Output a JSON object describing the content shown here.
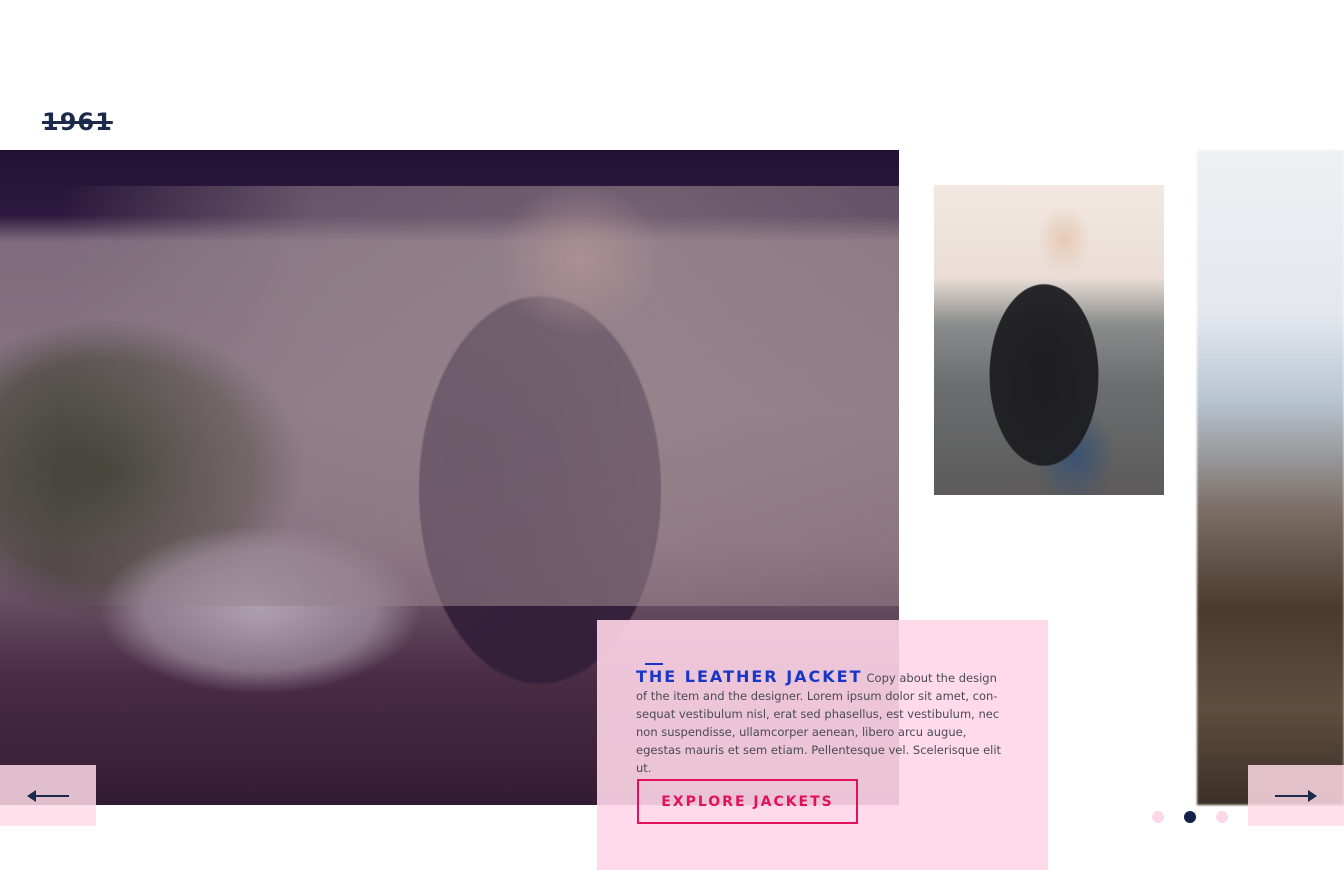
{
  "header": {
    "year": "1961"
  },
  "slide": {
    "title": "THE LEATHER JACKET",
    "copy": "Copy about the design of the item and the designer. Lorem ipsum dolor sit amet, con-sequat vestibulum nisl, erat sed phasellus, est vestibulum, nec non suspendisse, ullamcorper aenean, libero arcu augue, egestas mauris et sem etiam. Pellentesque vel. Scelerisque elit ut.",
    "cta_label": "EXPLORE JACKETS"
  },
  "navigation": {
    "prev_icon": "arrow-left-icon",
    "next_icon": "arrow-right-icon"
  },
  "pagination": {
    "total": 3,
    "active_index": 1
  },
  "colors": {
    "accent_blue": "#1836c8",
    "accent_pink": "#e2125a",
    "navy": "#13224a",
    "card_pink": "#ffd6e8"
  }
}
